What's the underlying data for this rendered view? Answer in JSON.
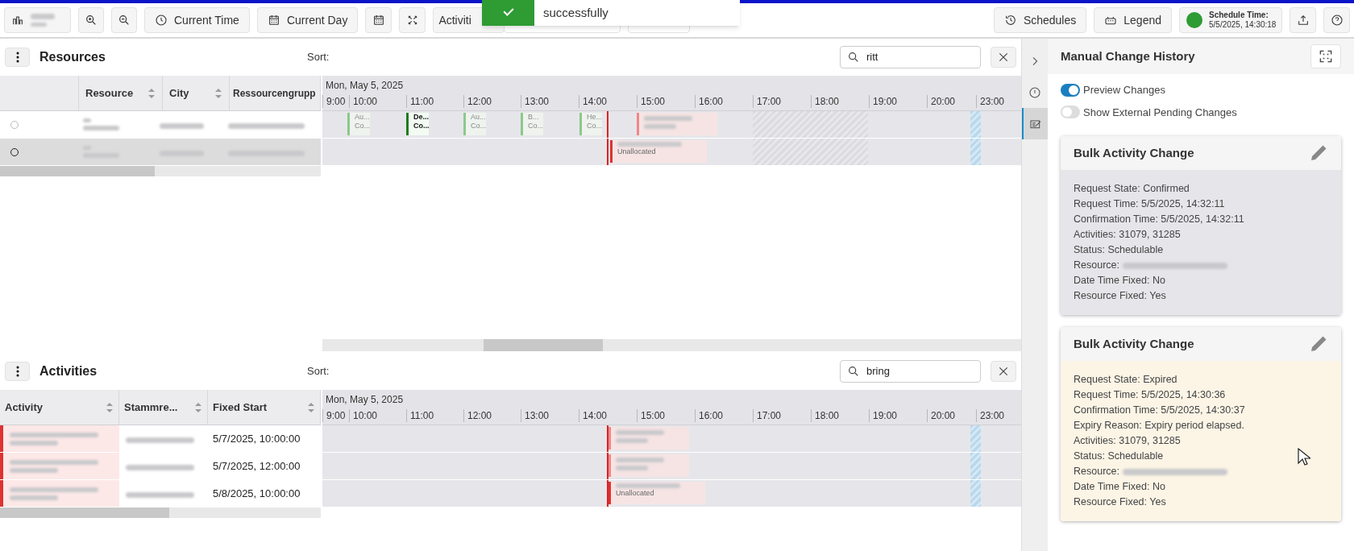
{
  "toolbar": {
    "left": [
      {
        "kind": "dataset"
      },
      {
        "kind": "zoom_in"
      },
      {
        "kind": "zoom_out"
      },
      {
        "kind": "current_time",
        "label": "Current Time"
      },
      {
        "kind": "current_day",
        "label": "Current Day"
      },
      {
        "kind": "calendar"
      },
      {
        "kind": "fit"
      },
      {
        "kind": "activities",
        "label": "Activiti"
      }
    ],
    "right": [
      {
        "kind": "schedules",
        "label": "Schedules"
      },
      {
        "kind": "legend",
        "label": "Legend"
      },
      {
        "kind": "schedule",
        "label": "Schedule Time:",
        "value": "5/5/2025, 14:30:18",
        "color": "#2e9b33"
      },
      {
        "kind": "export"
      },
      {
        "kind": "help"
      }
    ]
  },
  "toast": {
    "message": "successfully"
  },
  "resources": {
    "title": "Resources",
    "sort_label": "Sort:",
    "search": {
      "value": "ritt"
    },
    "columns": [
      "Resource",
      "City",
      "Ressourcengrupp"
    ],
    "rows": [
      {
        "selected": false
      },
      {
        "selected": true
      }
    ],
    "gantt": {
      "date": "Mon, May 5, 2025",
      "hours": [
        "9:00",
        "10:00",
        "11:00",
        "12:00",
        "13:00",
        "14:00",
        "15:00",
        "16:00",
        "17:00",
        "18:00",
        "19:00",
        "20:00",
        "23:00"
      ],
      "rows": [
        {
          "bars": [
            {
              "kind": "labeled",
              "line1": "Au...",
              "line2": "Co...",
              "selected": false
            },
            {
              "kind": "labeled",
              "line1": "De...",
              "line2": "Co...",
              "selected": true
            },
            {
              "kind": "labeled",
              "line1": "Au...",
              "line2": "Co...",
              "selected": false
            },
            {
              "kind": "labeled",
              "line1": "B...",
              "line2": "Co...",
              "selected": false
            },
            {
              "kind": "labeled",
              "line1": "He...",
              "line2": "Co...",
              "selected": false
            },
            {
              "kind": "blurred",
              "selected": false
            }
          ]
        },
        {
          "bars": [
            {
              "kind": "unallocated",
              "line2": "Unallocated",
              "selected": false
            }
          ]
        }
      ]
    }
  },
  "activities": {
    "title": "Activities",
    "sort_label": "Sort:",
    "search": {
      "value": "bring"
    },
    "columns": [
      "Activity",
      "Stammre...",
      "Fixed Start"
    ],
    "rows": [
      {
        "fixed_start": "5/7/2025, 10:00:00"
      },
      {
        "fixed_start": "5/7/2025, 12:00:00"
      },
      {
        "fixed_start": "5/8/2025, 10:00:00"
      }
    ],
    "gantt": {
      "date": "Mon, May 5, 2025",
      "hours": [
        "9:00",
        "10:00",
        "11:00",
        "12:00",
        "13:00",
        "14:00",
        "15:00",
        "16:00",
        "17:00",
        "18:00",
        "19:00",
        "20:00",
        "23:00"
      ],
      "rows": [
        {
          "bars": [
            {
              "kind": "blurred",
              "selected": false
            }
          ]
        },
        {
          "bars": [
            {
              "kind": "blurred",
              "selected": false
            }
          ]
        },
        {
          "bars": [
            {
              "kind": "unallocated",
              "line2": "Unallocated",
              "selected": false
            }
          ]
        }
      ]
    }
  },
  "side_tabs": [
    {
      "selected": false
    },
    {
      "selected": false
    },
    {
      "selected": true
    }
  ],
  "panel": {
    "title": "Manual Change History",
    "toggles": [
      {
        "label": "Preview Changes",
        "on": true
      },
      {
        "label": "Show External Pending Changes",
        "on": false
      }
    ],
    "cards": [
      {
        "title": "Bulk Activity Change",
        "kind": "confirmed",
        "lines": [
          {
            "text": "Request State: Confirmed"
          },
          {
            "text": "Request Time: 5/5/2025, 14:32:11"
          },
          {
            "text": "Confirmation Time: 5/5/2025, 14:32:11"
          },
          {
            "text": "Activities: 31079, 31285"
          },
          {
            "text": "Status: Schedulable"
          },
          {
            "text": "Resource:",
            "redacted": true
          },
          {
            "text": "Date Time Fixed: No"
          },
          {
            "text": "Resource Fixed: Yes"
          }
        ]
      },
      {
        "title": "Bulk Activity Change",
        "kind": "expired",
        "lines": [
          {
            "text": "Request State: Expired"
          },
          {
            "text": "Request Time: 5/5/2025, 14:30:36"
          },
          {
            "text": "Confirmation Time: 5/5/2025, 14:30:37"
          },
          {
            "text": "Expiry Reason: Expiry period elapsed."
          },
          {
            "text": "Activities: 31079, 31285"
          },
          {
            "text": "Status: Schedulable"
          },
          {
            "text": "Resource:",
            "redacted": true
          },
          {
            "text": "Date Time Fixed: No"
          },
          {
            "text": "Resource Fixed: Yes"
          }
        ]
      }
    ]
  }
}
